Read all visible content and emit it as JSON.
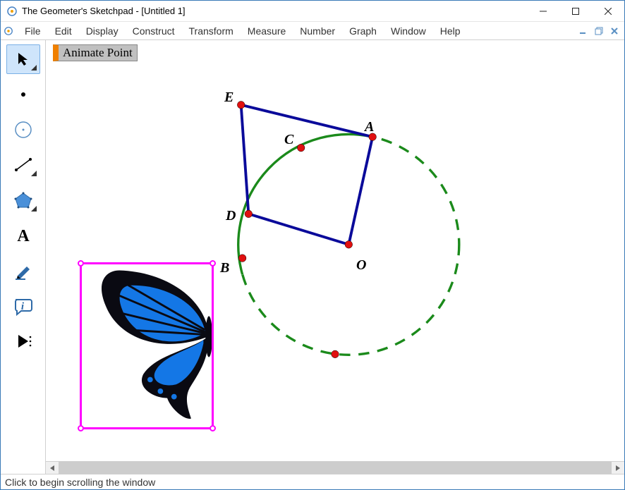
{
  "window": {
    "title": "The Geometer's Sketchpad - [Untitled 1]"
  },
  "menus": [
    "File",
    "Edit",
    "Display",
    "Construct",
    "Transform",
    "Measure",
    "Number",
    "Graph",
    "Window",
    "Help"
  ],
  "tools": [
    {
      "name": "arrow-tool",
      "selected": true,
      "flyout": true
    },
    {
      "name": "point-tool",
      "selected": false,
      "flyout": false
    },
    {
      "name": "compass-tool",
      "selected": false,
      "flyout": false
    },
    {
      "name": "straightedge-tool",
      "selected": false,
      "flyout": true
    },
    {
      "name": "polygon-tool",
      "selected": false,
      "flyout": true
    },
    {
      "name": "text-tool",
      "selected": false,
      "flyout": false
    },
    {
      "name": "marker-tool",
      "selected": false,
      "flyout": false
    },
    {
      "name": "info-tool",
      "selected": false,
      "flyout": false
    },
    {
      "name": "custom-tool",
      "selected": false,
      "flyout": true
    }
  ],
  "canvas": {
    "animate_button": "Animate Point",
    "labels": {
      "A": "A",
      "B": "B",
      "C": "C",
      "D": "D",
      "E": "E",
      "O": "O"
    }
  },
  "statusbar": {
    "text": "Click to begin scrolling the window"
  },
  "colors": {
    "circle": "#1b8a1b",
    "segment": "#0a0a9a",
    "point_fill": "#e01010",
    "point_stroke": "#000",
    "selection": "#ff00ff"
  }
}
